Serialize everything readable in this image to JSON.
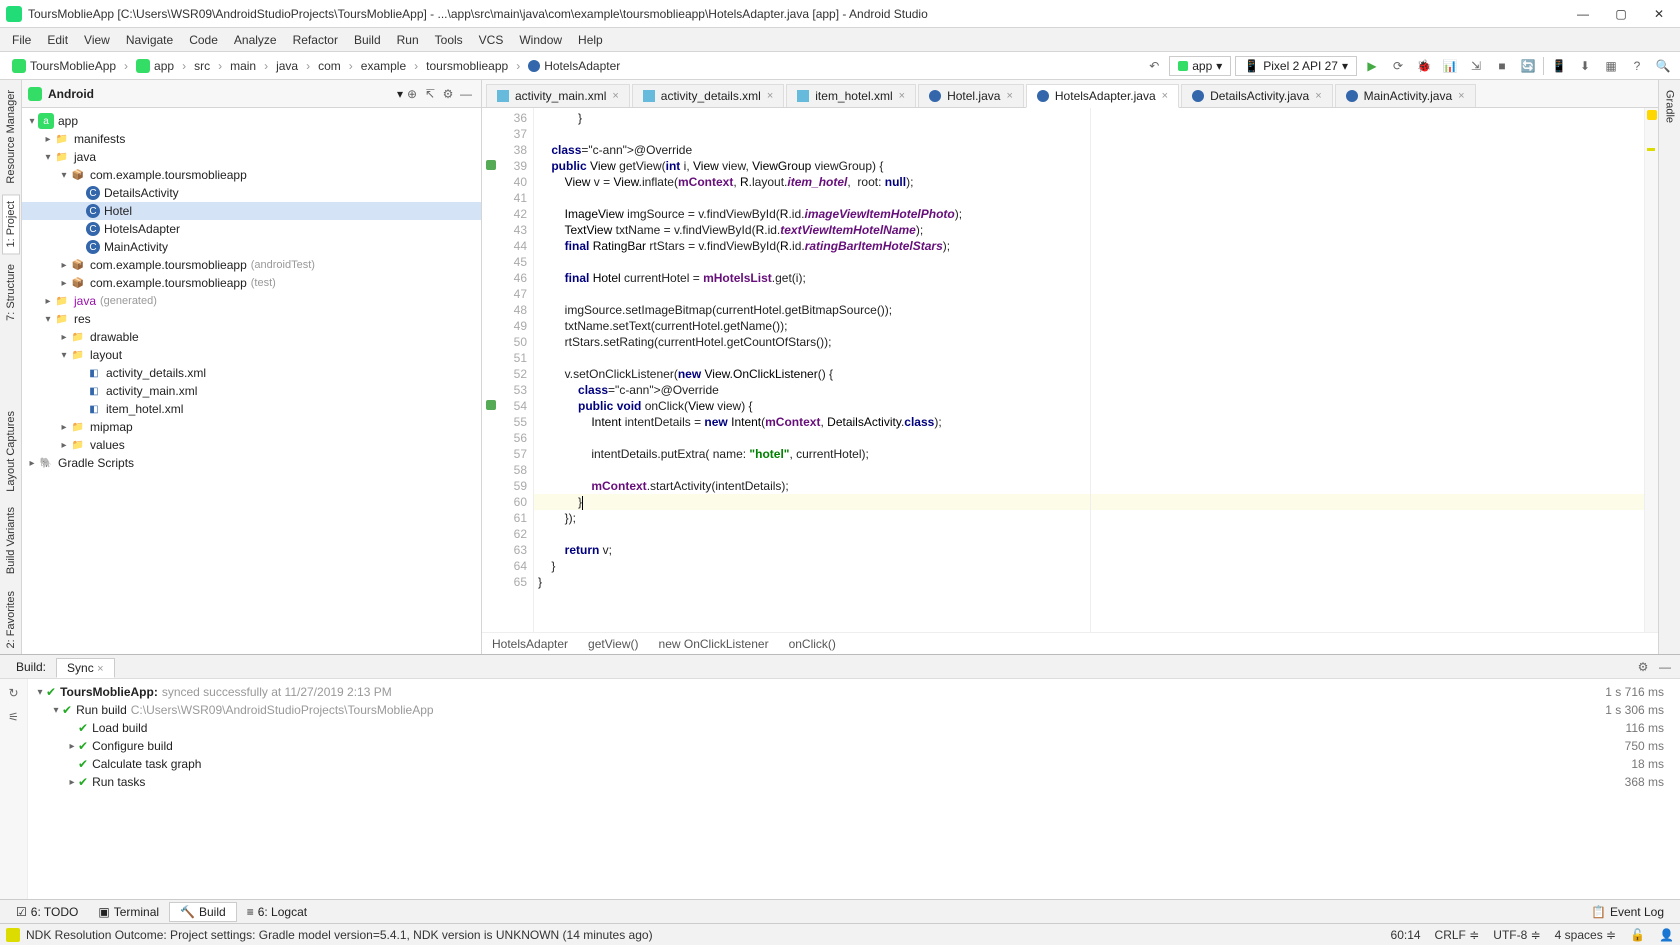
{
  "title": "ToursMoblieApp [C:\\Users\\WSR09\\AndroidStudioProjects\\ToursMoblieApp] - ...\\app\\src\\main\\java\\com\\example\\toursmoblieapp\\HotelsAdapter.java [app] - Android Studio",
  "menu": [
    "File",
    "Edit",
    "View",
    "Navigate",
    "Code",
    "Analyze",
    "Refactor",
    "Build",
    "Run",
    "Tools",
    "VCS",
    "Window",
    "Help"
  ],
  "breadcrumb": [
    "ToursMoblieApp",
    "app",
    "src",
    "main",
    "java",
    "com",
    "example",
    "toursmoblieapp",
    "HotelsAdapter"
  ],
  "run_config": "app",
  "device": "Pixel 2 API 27",
  "project_header": {
    "title": "Android"
  },
  "tree": {
    "app": "app",
    "manifests": "manifests",
    "java": "java",
    "pkg1": "com.example.toursmoblieapp",
    "detailsact": "DetailsActivity",
    "hotel": "Hotel",
    "hotelsadapter": "HotelsAdapter",
    "mainactivity": "MainActivity",
    "pkg2": "com.example.toursmoblieapp",
    "pkg2_suffix": "(androidTest)",
    "pkg3": "com.example.toursmoblieapp",
    "pkg3_suffix": "(test)",
    "java_gen": "java",
    "java_gen_suffix": "(generated)",
    "res": "res",
    "drawable": "drawable",
    "layout": "layout",
    "f_actdet": "activity_details.xml",
    "f_actmain": "activity_main.xml",
    "f_itemhotel": "item_hotel.xml",
    "mipmap": "mipmap",
    "values": "values",
    "gradle": "Gradle Scripts"
  },
  "side_tabs_left": {
    "resource_manager": "Resource Manager",
    "project": "1: Project",
    "structure": "7: Structure",
    "layout_captures": "Layout Captures",
    "build_variants": "Build Variants",
    "favorites": "2: Favorites"
  },
  "side_tabs_right": {
    "gradle": "Gradle"
  },
  "editor_tabs": [
    {
      "label": "activity_main.xml",
      "type": "xml",
      "active": false
    },
    {
      "label": "activity_details.xml",
      "type": "xml",
      "active": false
    },
    {
      "label": "item_hotel.xml",
      "type": "xml",
      "active": false
    },
    {
      "label": "Hotel.java",
      "type": "java",
      "active": false
    },
    {
      "label": "HotelsAdapter.java",
      "type": "java",
      "active": true
    },
    {
      "label": "DetailsActivity.java",
      "type": "java",
      "active": false
    },
    {
      "label": "MainActivity.java",
      "type": "java",
      "active": false
    }
  ],
  "line_start": 36,
  "code_lines": [
    {
      "n": 36,
      "t": "            }"
    },
    {
      "n": 37,
      "t": ""
    },
    {
      "n": 38,
      "t": "    @Override",
      "ann": true
    },
    {
      "n": 39,
      "t": "    public View getView(int i, View view, ViewGroup viewGroup) {",
      "sig": true,
      "marker": true
    },
    {
      "n": 40,
      "t": "        View v = View.inflate(mContext, R.layout.item_hotel,  root: null);"
    },
    {
      "n": 41,
      "t": ""
    },
    {
      "n": 42,
      "t": "        ImageView imgSource = v.findViewById(R.id.imageViewItemHotelPhoto);"
    },
    {
      "n": 43,
      "t": "        TextView txtName = v.findViewById(R.id.textViewItemHotelName);"
    },
    {
      "n": 44,
      "t": "        final RatingBar rtStars = v.findViewById(R.id.ratingBarItemHotelStars);"
    },
    {
      "n": 45,
      "t": ""
    },
    {
      "n": 46,
      "t": "        final Hotel currentHotel = mHotelsList.get(i);"
    },
    {
      "n": 47,
      "t": ""
    },
    {
      "n": 48,
      "t": "        imgSource.setImageBitmap(currentHotel.getBitmapSource());"
    },
    {
      "n": 49,
      "t": "        txtName.setText(currentHotel.getName());"
    },
    {
      "n": 50,
      "t": "        rtStars.setRating(currentHotel.getCountOfStars());"
    },
    {
      "n": 51,
      "t": ""
    },
    {
      "n": 52,
      "t": "        v.setOnClickListener(new View.OnClickListener() {"
    },
    {
      "n": 53,
      "t": "            @Override",
      "ann": true
    },
    {
      "n": 54,
      "t": "            public void onClick(View view) {",
      "sig": true,
      "marker": true
    },
    {
      "n": 55,
      "t": "                Intent intentDetails = new Intent(mContext, DetailsActivity.class);"
    },
    {
      "n": 56,
      "t": ""
    },
    {
      "n": 57,
      "t": "                intentDetails.putExtra( name: \"hotel\", currentHotel);"
    },
    {
      "n": 58,
      "t": ""
    },
    {
      "n": 59,
      "t": "                mContext.startActivity(intentDetails);"
    },
    {
      "n": 60,
      "t": "            }",
      "hl": true,
      "cursor": true
    },
    {
      "n": 61,
      "t": "        });"
    },
    {
      "n": 62,
      "t": ""
    },
    {
      "n": 63,
      "t": "        return v;"
    },
    {
      "n": 64,
      "t": "    }"
    },
    {
      "n": 65,
      "t": "}"
    }
  ],
  "editor_breadcrumb": [
    "HotelsAdapter",
    "getView()",
    "new OnClickListener",
    "onClick()"
  ],
  "build": {
    "tab1": "Build:",
    "tab2": "Sync",
    "root": "ToursMoblieApp:",
    "root_suffix": "synced successfully at 11/27/2019 2:13 PM",
    "runbuild": "Run build",
    "runbuild_path": "C:\\Users\\WSR09\\AndroidStudioProjects\\ToursMoblieApp",
    "load": "Load build",
    "configure": "Configure build",
    "taskgraph": "Calculate task graph",
    "runtasks": "Run tasks",
    "times": [
      "1 s 716 ms",
      "1 s 306 ms",
      "116 ms",
      "750 ms",
      "18 ms",
      "368 ms"
    ]
  },
  "bottom_tabs": {
    "todo": "6: TODO",
    "terminal": "Terminal",
    "build": "Build",
    "logcat": "6: Logcat",
    "eventlog": "Event Log"
  },
  "status_left": "NDK Resolution Outcome: Project settings: Gradle model version=5.4.1, NDK version is UNKNOWN (14 minutes ago)",
  "status_right": {
    "pos": "60:14",
    "lineend": "CRLF",
    "enc": "UTF-8",
    "indent": "4 spaces"
  }
}
